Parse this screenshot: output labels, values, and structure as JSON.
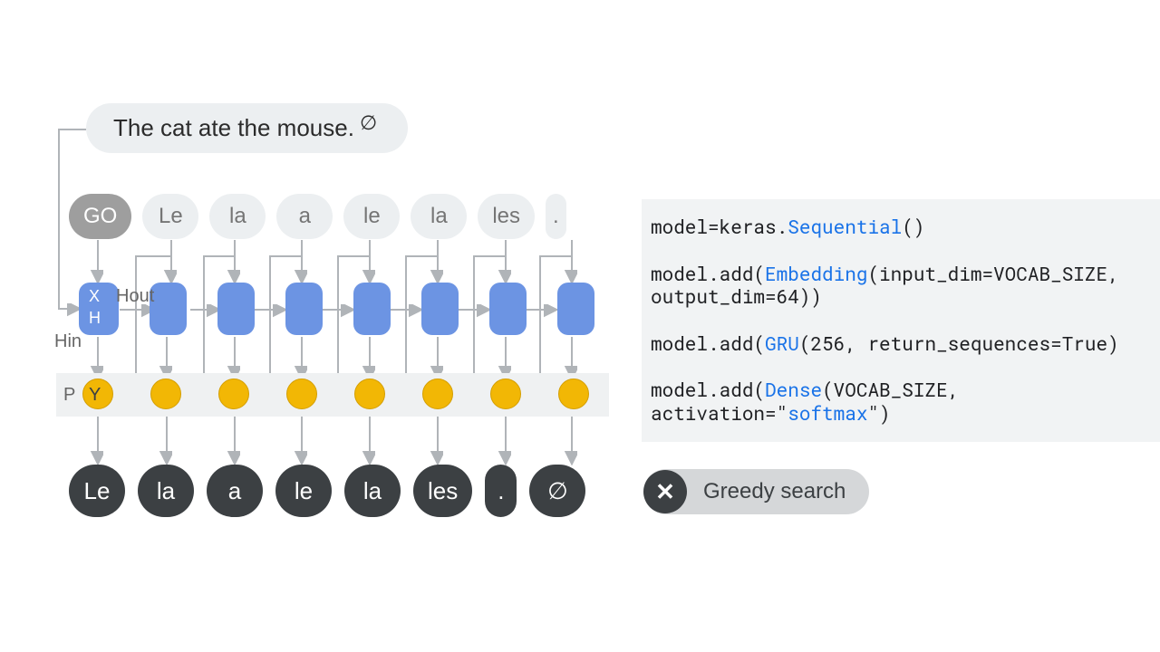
{
  "input_sentence": "The cat ate the mouse.",
  "end_symbol": "∅",
  "top_tokens": [
    "GO",
    "Le",
    "la",
    "a",
    "le",
    "la",
    "les",
    "."
  ],
  "cell_labels": {
    "x": "X",
    "h": "H",
    "hin": "Hin",
    "hout": "Hout",
    "p": "P",
    "y": "Y"
  },
  "output_tokens": [
    "Le",
    "la",
    "a",
    "le",
    "la",
    "les",
    ".",
    "∅"
  ],
  "greedy_label": "Greedy search",
  "code": {
    "l1_a": "model=keras.",
    "l1_b": "Sequential",
    "l1_c": "()",
    "l2_a": "model.add(",
    "l2_b": "Embedding",
    "l2_c": "(input_dim=VOCAB_SIZE, output_dim=64))",
    "l3_a": "model.add(",
    "l3_b": "GRU",
    "l3_c": "(256, return_sequences=True)",
    "l4_a": "model.add(",
    "l4_b": "Dense",
    "l4_c": "(VOCAB_SIZE, activation=\"",
    "l4_d": "softmax",
    "l4_e": "\")"
  }
}
